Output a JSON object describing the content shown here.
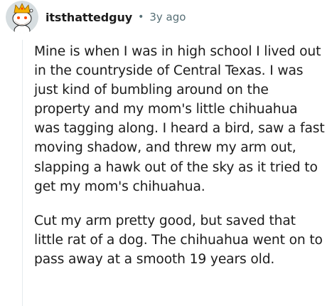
{
  "comment": {
    "author": "itsthattedguy",
    "separator": "•",
    "time": "3y ago",
    "avatar_icon": "snoo-avatar-with-crown",
    "paragraphs": [
      "Mine is when I was in high school I lived out in the countryside of Central Texas. I was just kind of bumbling around on the property and my mom's little chihuahua was tagging along. I heard a bird, saw a fast moving shadow, and threw my arm out, slapping a hawk out of the sky as it tried to get my mom's chihuahua.",
      "Cut my arm pretty good, but saved that little rat of a dog. The chihuahua went on to pass away at a smooth 19 years old."
    ]
  },
  "colors": {
    "text": "#1c1c1c",
    "meta": "#576f76",
    "thread_line": "#e5ebee",
    "avatar_bg": "#d6dde0"
  }
}
